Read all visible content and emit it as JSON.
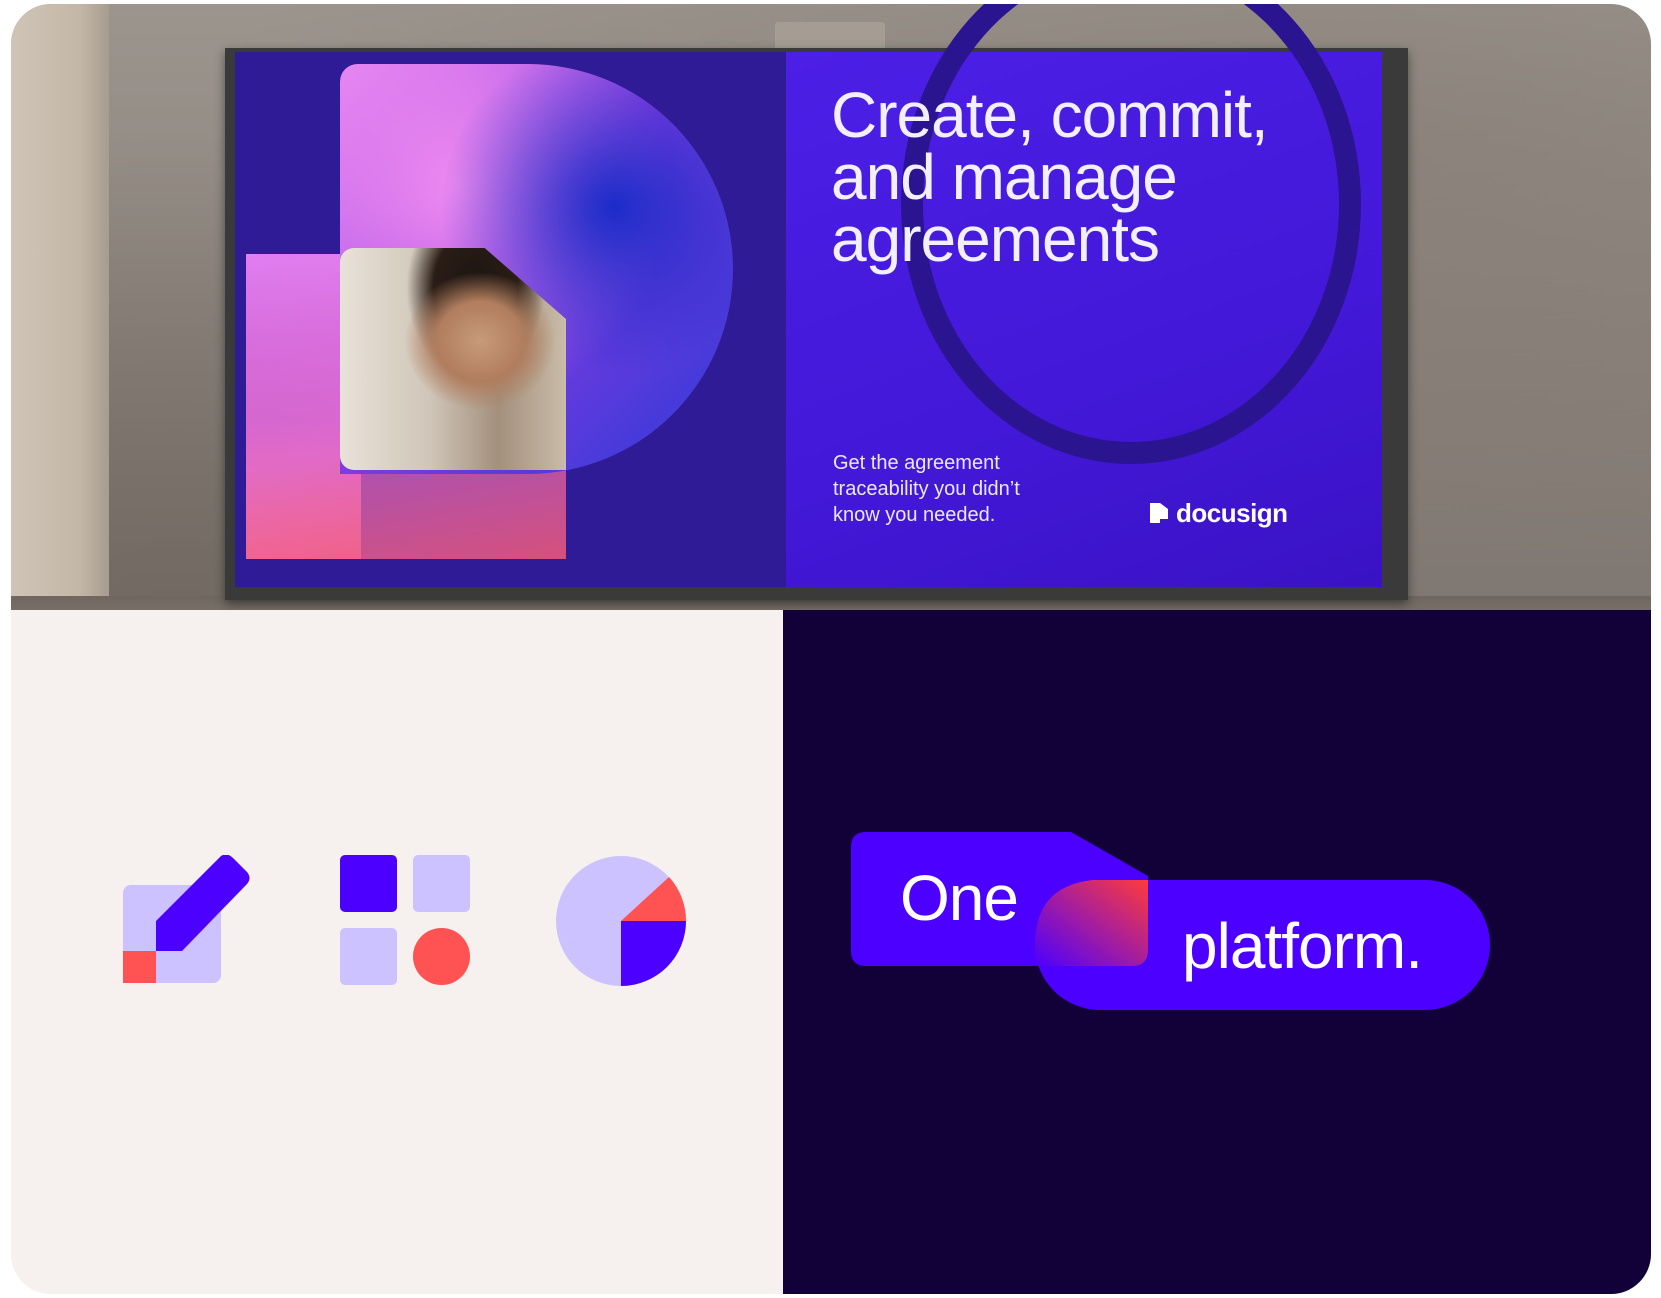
{
  "billboard": {
    "headline_lines": [
      "Create, commit,",
      "and manage",
      "agreements"
    ],
    "subtext_lines": [
      "Get the agreement",
      "traceability you didn’t",
      "know you needed."
    ],
    "brand": "docusign"
  },
  "tagline": {
    "word_1": "One",
    "word_2": "platform."
  },
  "colors": {
    "cobalt": "#4c00ff",
    "deep_violet": "#120038",
    "lavender": "#cbc2ff",
    "poppy": "#ff5252",
    "ecru": "#f6f1ee"
  },
  "icons": [
    "edit-icon",
    "grid-blocks-icon",
    "pie-chart-icon"
  ]
}
